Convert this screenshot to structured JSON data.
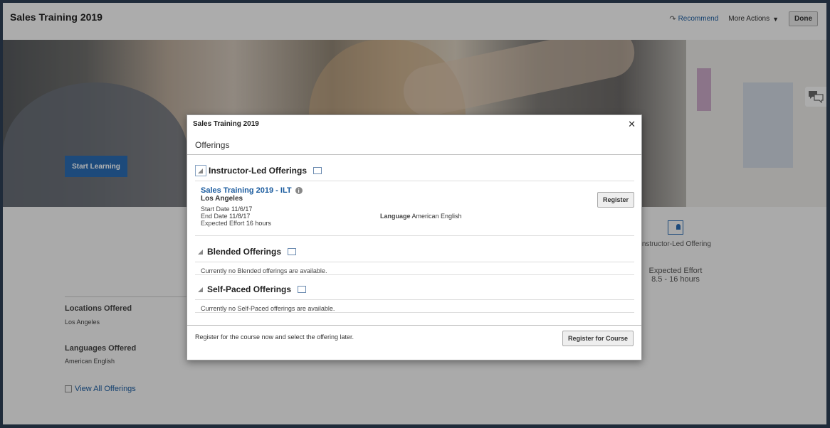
{
  "header": {
    "title": "Sales Training 2019",
    "recommend_label": "Recommend",
    "more_actions_label": "More Actions",
    "done_label": "Done"
  },
  "hero": {
    "start_learning_label": "Start Learning"
  },
  "details": {
    "locations_label": "Locations Offered",
    "locations_value": "Los Angeles",
    "languages_label": "Languages Offered",
    "languages_value": "American English",
    "view_all_label": "View All Offerings"
  },
  "side_panel": {
    "type_label": "Instructor-Led Offering",
    "effort_label": "Expected Effort",
    "effort_value": "8.5 - 16 hours"
  },
  "dialog": {
    "title": "Sales Training 2019",
    "close_glyph": "✕",
    "subtitle": "Offerings",
    "instructor_led": {
      "heading": "Instructor-Led Offerings",
      "offering": {
        "name": "Sales Training 2019 - ILT",
        "location": "Los Angeles",
        "start_date_label": "Start Date",
        "start_date": "11/6/17",
        "end_date_label": "End Date",
        "end_date": "11/8/17",
        "effort_label": "Expected Effort",
        "effort": "16 hours",
        "language_label": "Language",
        "language": "American English",
        "register_label": "Register"
      }
    },
    "blended": {
      "heading": "Blended Offerings",
      "empty_text": "Currently no Blended offerings are available."
    },
    "self_paced": {
      "heading": "Self-Paced Offerings",
      "empty_text": "Currently no Self-Paced offerings are available."
    },
    "footer_text": "Register for the course now and select the offering later.",
    "register_course_label": "Register for Course"
  }
}
